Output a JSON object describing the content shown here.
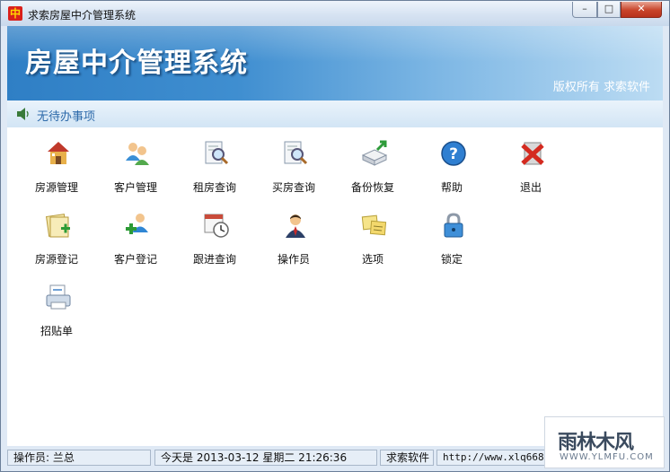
{
  "window": {
    "title": "求索房屋中介管理系统",
    "app_icon_text": "中",
    "min_glyph": "–",
    "max_glyph": "□",
    "close_glyph": "✕"
  },
  "banner": {
    "title": "房屋中介管理系统",
    "copyright": "版权所有 求索软件"
  },
  "todo": {
    "text": "无待办事项"
  },
  "toolbar": {
    "row1": [
      {
        "label": "房源管理",
        "icon": "house-icon"
      },
      {
        "label": "客户管理",
        "icon": "users-icon"
      },
      {
        "label": "租房查询",
        "icon": "search-doc-icon"
      },
      {
        "label": "买房查询",
        "icon": "search-doc-icon"
      },
      {
        "label": "备份恢复",
        "icon": "backup-icon"
      },
      {
        "label": "帮助",
        "icon": "help-icon"
      },
      {
        "label": "退出",
        "icon": "exit-icon"
      }
    ],
    "row2": [
      {
        "label": "房源登记",
        "icon": "folder-add-icon"
      },
      {
        "label": "客户登记",
        "icon": "user-add-icon"
      },
      {
        "label": "跟进查询",
        "icon": "calendar-clock-icon"
      },
      {
        "label": "操作员",
        "icon": "operator-icon"
      },
      {
        "label": "选项",
        "icon": "notes-icon"
      },
      {
        "label": "锁定",
        "icon": "lock-icon"
      }
    ],
    "row3": [
      {
        "label": "招贴单",
        "icon": "print-icon"
      }
    ]
  },
  "status": {
    "operator": "操作员: 兰总",
    "datetime": "今天是 2013-03-12 星期二 21:26:36",
    "company": "求索软件",
    "url": "http://www.xlq668.co"
  },
  "watermark": {
    "big": "雨林木风",
    "small": "WWW.YLMFU.COM"
  },
  "colors": {
    "banner_start": "#2f7fc5",
    "banner_end": "#bcdcf3",
    "todo_text": "#2d6aaa",
    "close_button": "#c8442a"
  }
}
